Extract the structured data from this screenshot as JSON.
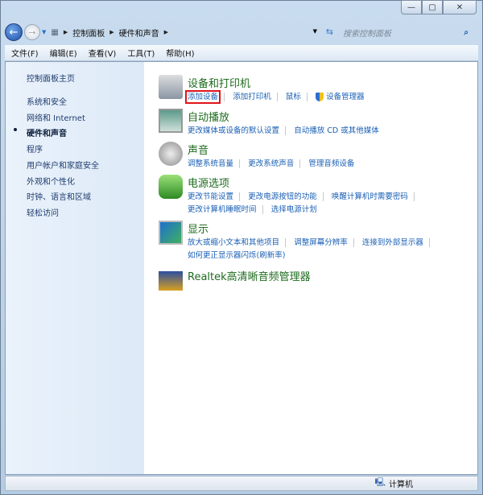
{
  "window": {
    "minimize": "—",
    "maximize": "▢",
    "close": "✕"
  },
  "address": {
    "back": "←",
    "forward": "→",
    "crumbs": [
      "控制面板",
      "硬件和声音"
    ],
    "search_placeholder": "搜索控制面板",
    "search_icon": "magnifier-icon"
  },
  "menu": [
    "文件(F)",
    "编辑(E)",
    "查看(V)",
    "工具(T)",
    "帮助(H)"
  ],
  "sidebar": {
    "items": [
      "控制面板主页",
      "系统和安全",
      "网络和 Internet",
      "硬件和声音",
      "程序",
      "用户帐户和家庭安全",
      "外观和个性化",
      "时钟、语言和区域",
      "轻松访问"
    ],
    "current": 3
  },
  "sections": [
    {
      "title": "设备和打印机",
      "icon": "printer-icon",
      "links": [
        "添加设备",
        "添加打印机",
        "鼠标",
        "设备管理器"
      ]
    },
    {
      "title": "自动播放",
      "icon": "autoplay-icon",
      "links": [
        "更改媒体或设备的默认设置",
        "自动播放 CD 或其他媒体"
      ]
    },
    {
      "title": "声音",
      "icon": "speaker-icon",
      "links": [
        "调整系统音量",
        "更改系统声音",
        "管理音频设备"
      ]
    },
    {
      "title": "电源选项",
      "icon": "battery-icon",
      "links": [
        "更改节能设置",
        "更改电源按钮的功能",
        "唤醒计算机时需要密码",
        "更改计算机睡眠时间",
        "选择电源计划"
      ]
    },
    {
      "title": "显示",
      "icon": "monitor-icon",
      "links": [
        "放大或缩小文本和其他项目",
        "调整屏幕分辨率",
        "连接到外部显示器",
        "如何更正显示器闪烁(刷新率)"
      ]
    },
    {
      "title": "Realtek高清晰音频管理器",
      "icon": "realtek-icon",
      "links": []
    }
  ],
  "status": {
    "text": "计算机"
  }
}
